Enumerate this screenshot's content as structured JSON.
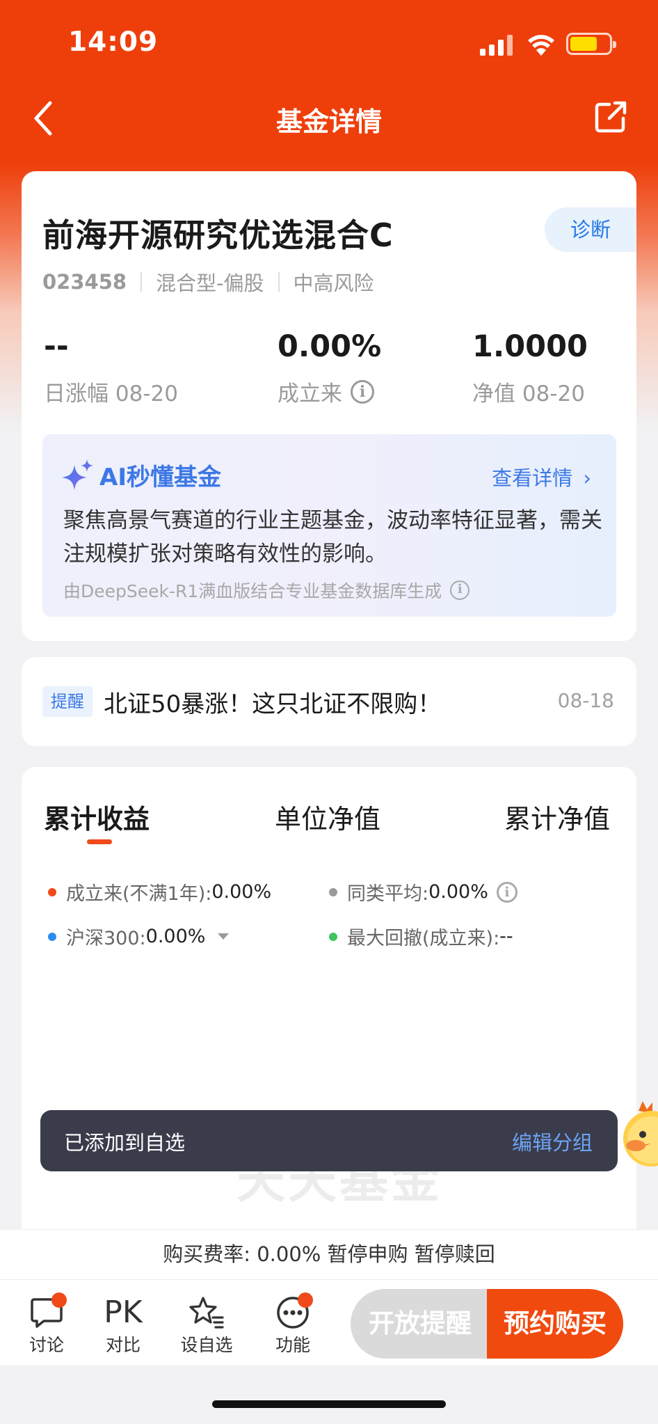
{
  "status_bar": {
    "time": "14:09"
  },
  "navbar": {
    "title": "基金详情"
  },
  "fund": {
    "name": "前海开源研究优选混合C",
    "diagnose_label": "诊断",
    "code": "023458",
    "type": "混合型-偏股",
    "risk": "中高风险",
    "stats": [
      {
        "value": "--",
        "label": "日涨幅 08-20"
      },
      {
        "value": "0.00%",
        "label": "成立来"
      },
      {
        "value": "1.0000",
        "label": "净值 08-20"
      }
    ]
  },
  "ai": {
    "title": "AI秒懂基金",
    "more": "查看详情",
    "text": "聚焦高景气赛道的行业主题基金，波动率特征显著，需关注规模扩张对策略有效性的影响。",
    "footer": "由DeepSeek-R1满血版结合专业基金数据库生成"
  },
  "notice": {
    "tag": "提醒",
    "text": "北证50暴涨！这只北证不限购！",
    "date": "08-18"
  },
  "chart_tabs": [
    "累计收益",
    "单位净值",
    "累计净值"
  ],
  "legend": [
    {
      "label": "成立来(不满1年):",
      "value": "0.00%",
      "color": "#f04a1a"
    },
    {
      "label": "同类平均:",
      "value": "0.00%",
      "color": "#9a9a9a"
    },
    {
      "label": "沪深300:",
      "value": "0.00%",
      "color": "#2d8cf0"
    },
    {
      "label": "最大回撤(成立来):",
      "value": "--",
      "color": "#3fc55f"
    }
  ],
  "watermark": "天天基金",
  "toast": {
    "text": "已添加到自选",
    "action": "编辑分组"
  },
  "fee_bar": {
    "text": "购买费率:  0.00%  暂停申购  暂停赎回"
  },
  "tabbar": [
    {
      "label": "讨论",
      "icon": "chat-bubble-icon"
    },
    {
      "label": "对比",
      "icon": "pk-icon",
      "glyph": "PK"
    },
    {
      "label": "设自选",
      "icon": "star-list-icon"
    },
    {
      "label": "功能",
      "icon": "more-dots-icon"
    }
  ],
  "actions": {
    "remind": "开放提醒",
    "buy": "预约购买"
  }
}
